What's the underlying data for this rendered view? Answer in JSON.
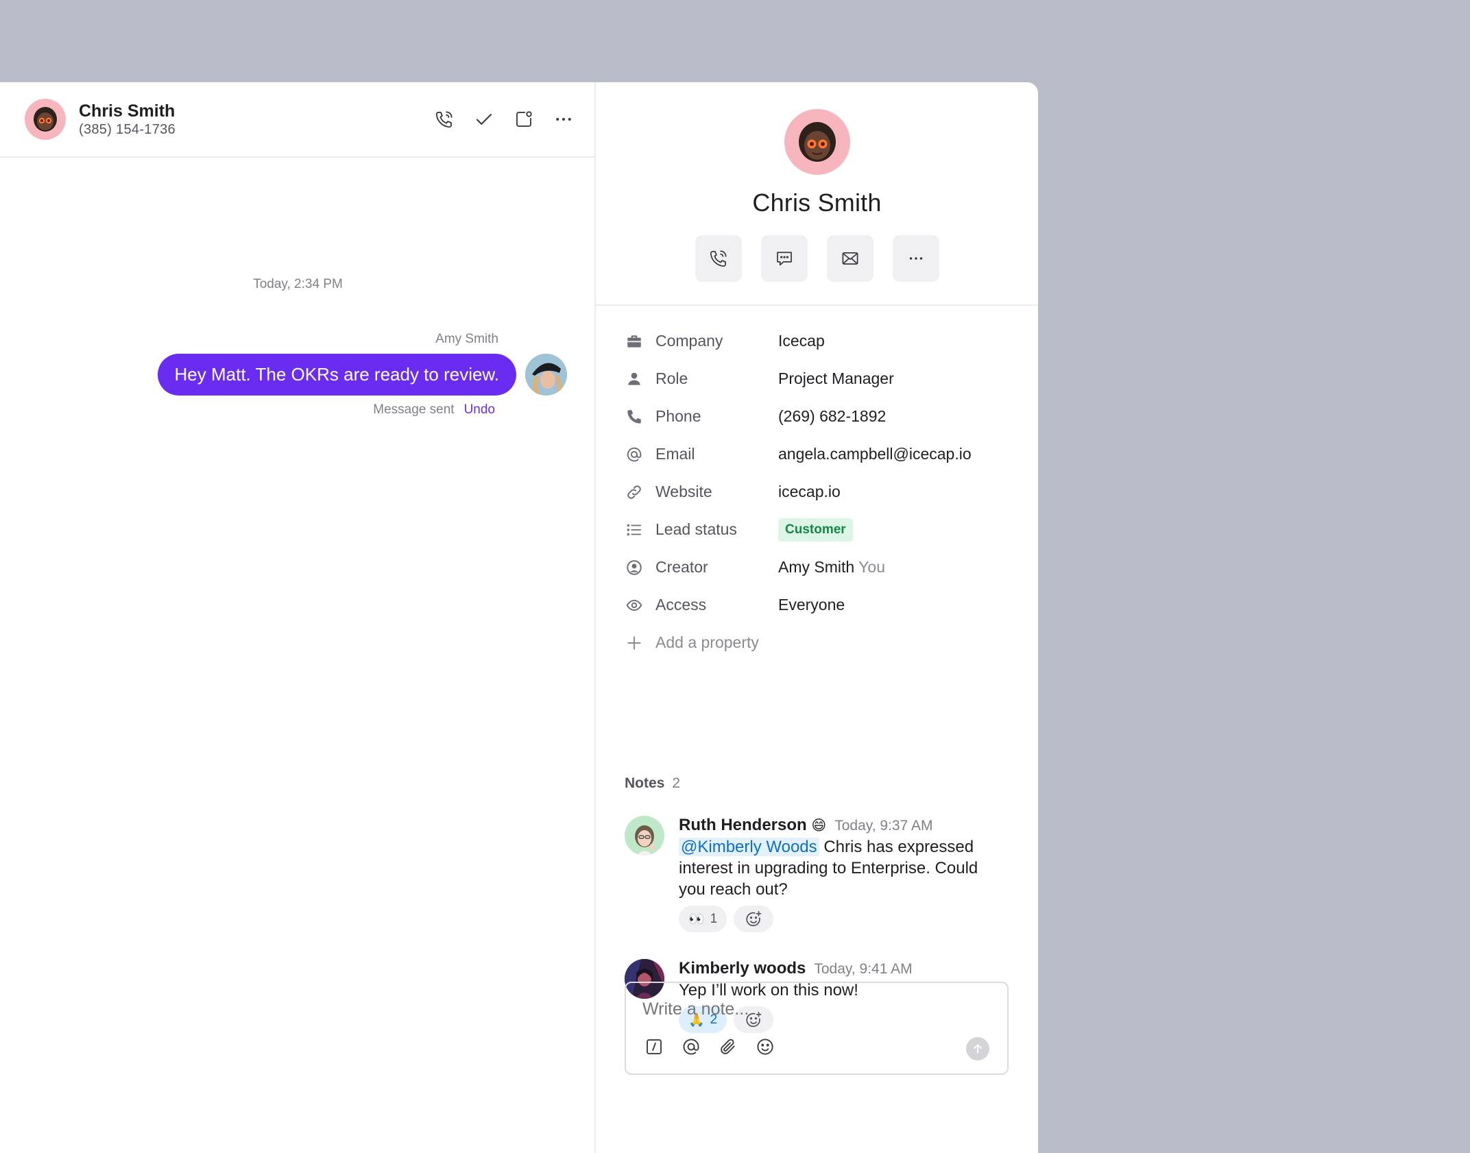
{
  "chat": {
    "contact_name": "Chris Smith",
    "contact_phone": "(385) 154-1736",
    "timestamp": "Today, 2:34 PM",
    "sender_name": "Amy Smith",
    "message_text": "Hey Matt. The OKRs are ready to review.",
    "message_status": "Message sent",
    "undo_label": "Undo",
    "header_icons": [
      "phone-icon",
      "check-icon",
      "open-panel-icon",
      "more-icon"
    ]
  },
  "profile": {
    "name": "Chris Smith",
    "actions": [
      "phone-icon",
      "chat-icon",
      "mail-icon",
      "more-icon"
    ]
  },
  "properties": {
    "company": {
      "label": "Company",
      "value": "Icecap"
    },
    "role": {
      "label": "Role",
      "value": "Project Manager"
    },
    "phone": {
      "label": "Phone",
      "value": "(269) 682-1892"
    },
    "email": {
      "label": "Email",
      "value": "angela.campbell@icecap.io"
    },
    "website": {
      "label": "Website",
      "value": "icecap.io"
    },
    "lead_status": {
      "label": "Lead status",
      "value": "Customer"
    },
    "creator": {
      "label": "Creator",
      "value": "Amy Smith",
      "suffix": "You"
    },
    "access": {
      "label": "Access",
      "value": "Everyone"
    },
    "add": {
      "label": "Add a property"
    }
  },
  "notes": {
    "title": "Notes",
    "count": "2",
    "items": [
      {
        "author": "Ruth Henderson",
        "author_emoji": "😄",
        "time": "Today, 9:37 AM",
        "mention": "@Kimberly Woods",
        "text": "Chris has expressed interest in upgrading to Enterprise. Could you reach out?",
        "reaction_emoji": "👀",
        "reaction_count": "1"
      },
      {
        "author": "Kimberly woods",
        "time": "Today, 9:41 AM",
        "text": "Yep I’ll work on this now!",
        "reaction_emoji": "🙏",
        "reaction_count": "2"
      }
    ]
  },
  "composer": {
    "placeholder": "Write a note..."
  },
  "colors": {
    "accent": "#6a2cf0",
    "background": "#bbbcc9",
    "badge_bg": "#dcf5e6",
    "badge_text": "#17864a",
    "mention": "#0d6fc9"
  }
}
